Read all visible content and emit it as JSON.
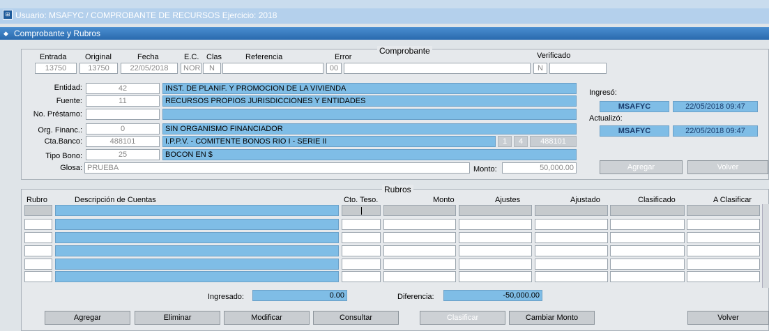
{
  "window": {
    "title": "Usuario: MSAFYC  /  COMPROBANTE DE RECURSOS  Ejercicio: 2018",
    "form_title": "Comprobante y Rubros"
  },
  "comprobante": {
    "section_title": "Comprobante",
    "headers": {
      "entrada": "Entrada",
      "original": "Original",
      "fecha": "Fecha",
      "ec": "E.C.",
      "clas": "Clas",
      "referencia": "Referencia",
      "error": "Error",
      "verificado": "Verificado"
    },
    "values": {
      "entrada": "13750",
      "original": "13750",
      "fecha": "22/05/2018",
      "ec": "NOR",
      "clas": "N",
      "referencia": "",
      "error": "00",
      "error_desc": "",
      "verificado": "N",
      "verificado_desc": ""
    },
    "fields": {
      "entidad_label": "Entidad:",
      "entidad_code": "42",
      "entidad_desc": "INST. DE PLANIF. Y PROMOCION DE LA VIVIENDA",
      "fuente_label": "Fuente:",
      "fuente_code": "11",
      "fuente_desc": "RECURSOS PROPIOS JURISDICCIONES Y ENTIDADES",
      "prestamo_label": "No. Préstamo:",
      "prestamo_code": "",
      "prestamo_desc": "",
      "org_label": "Org. Financ.:",
      "org_code": "0",
      "org_desc": "SIN ORGANISMO FINANCIADOR",
      "banco_label": "Cta.Banco:",
      "banco_code": "488101",
      "banco_desc": "I.P.P.V. - COMITENTE BONOS RIO I - SERIE II",
      "banco_n1": "1",
      "banco_n2": "4",
      "banco_n3": "488101",
      "bono_label": "Tipo Bono:",
      "bono_code": "25",
      "bono_desc": "BOCON EN $",
      "glosa_label": "Glosa:",
      "glosa_value": "PRUEBA",
      "monto_label": "Monto:",
      "monto_value": "50,000.00"
    },
    "audit": {
      "ingreso_label": "Ingresó:",
      "ingreso_user": "MSAFYC",
      "ingreso_date": "22/05/2018 09:47",
      "actualizo_label": "Actualizó:",
      "actualizo_user": "MSAFYC",
      "actualizo_date": "22/05/2018 09:47"
    },
    "buttons": {
      "agregar": "Agregar",
      "volver": "Volver"
    }
  },
  "rubros": {
    "section_title": "Rubros",
    "columns": {
      "rubro": "Rubro",
      "descripcion": "Descripción de Cuentas",
      "cto_teso": "Cto. Teso.",
      "monto": "Monto",
      "ajustes": "Ajustes",
      "ajustado": "Ajustado",
      "clasificado": "Clasificado",
      "a_clasificar": "A Clasificar"
    },
    "totals": {
      "ingresado_label": "Ingresado:",
      "ingresado_value": "0.00",
      "diferencia_label": "Diferencia:",
      "diferencia_value": "-50,000.00"
    },
    "buttons": {
      "agregar": "Agregar",
      "eliminar": "Eliminar",
      "modificar": "Modificar",
      "consultar": "Consultar",
      "clasificar": "Clasificar",
      "cambiar_monto": "Cambiar Monto",
      "volver": "Volver"
    }
  },
  "colors": {
    "accent_blue": "#7fbde6",
    "title_blue": "#2a6aae"
  }
}
